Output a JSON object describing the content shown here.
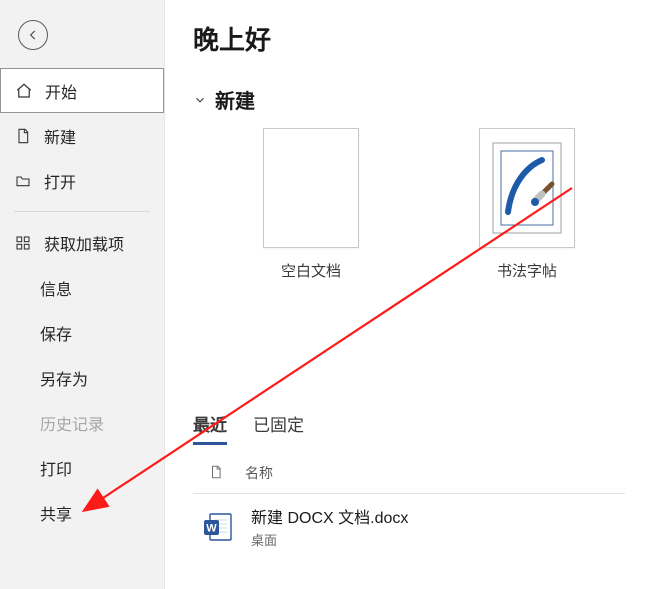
{
  "greeting": "晚上好",
  "sidebar": {
    "items": [
      {
        "label": "开始",
        "icon": "home"
      },
      {
        "label": "新建",
        "icon": "doc"
      },
      {
        "label": "打开",
        "icon": "folder"
      },
      {
        "label": "获取加载项",
        "icon": "apps"
      },
      {
        "label": "信息"
      },
      {
        "label": "保存"
      },
      {
        "label": "另存为"
      },
      {
        "label": "历史记录"
      },
      {
        "label": "打印"
      },
      {
        "label": "共享"
      }
    ]
  },
  "sections": {
    "new": {
      "title": "新建",
      "templates": [
        {
          "label": "空白文档"
        },
        {
          "label": "书法字帖"
        }
      ]
    }
  },
  "tabs": {
    "recent": "最近",
    "pinned": "已固定"
  },
  "file_list": {
    "header_name": "名称",
    "rows": [
      {
        "name": "新建 DOCX 文档.docx",
        "location": "桌面"
      }
    ]
  }
}
